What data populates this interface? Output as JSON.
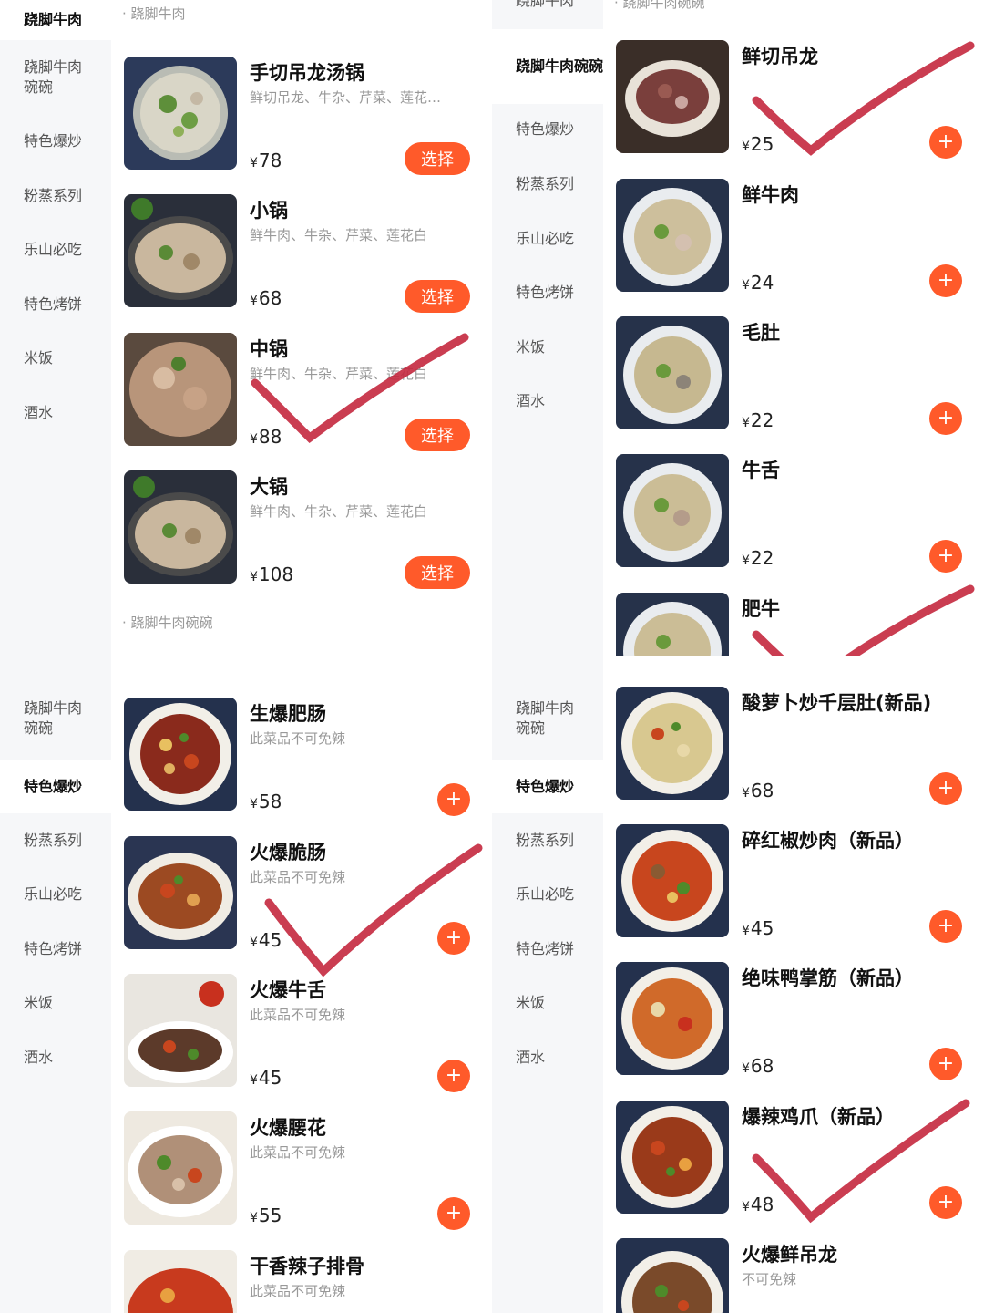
{
  "colors": {
    "accent": "#ff5a2a",
    "sidebar_bg": "#f6f7f9",
    "check_mark": "#c4283e"
  },
  "icons": {
    "add": "plus-icon"
  },
  "symbols": {
    "yen": "¥",
    "plus": "+",
    "ellipsis": "…"
  },
  "panels": [
    {
      "sidebar": [
        {
          "label": "跷脚牛肉",
          "active": true
        },
        {
          "label": "跷脚牛肉碗碗"
        },
        {
          "label": "特色爆炒"
        },
        {
          "label": "粉蒸系列"
        },
        {
          "label": "乐山必吃"
        },
        {
          "label": "特色烤饼"
        },
        {
          "label": "米饭"
        },
        {
          "label": "酒水"
        }
      ],
      "section_top": "· 跷脚牛肉",
      "section_bottom": "· 跷脚牛肉碗碗",
      "button_label": "选择",
      "items": [
        {
          "name": "手切吊龙汤锅",
          "desc": "鲜切吊龙、牛杂、芹菜、莲花…",
          "price": "78"
        },
        {
          "name": "小锅",
          "desc": "鲜牛肉、牛杂、芹菜、莲花白",
          "price": "68"
        },
        {
          "name": "中锅",
          "desc": "鲜牛肉、牛杂、芹菜、莲花白",
          "price": "88"
        },
        {
          "name": "大锅",
          "desc": "鲜牛肉、牛杂、芹菜、莲花白",
          "price": "108"
        }
      ]
    },
    {
      "sidebar": [
        {
          "label": "跷脚牛肉"
        },
        {
          "label": "跷脚牛肉碗碗",
          "active": true
        },
        {
          "label": "特色爆炒"
        },
        {
          "label": "粉蒸系列"
        },
        {
          "label": "乐山必吃"
        },
        {
          "label": "特色烤饼"
        },
        {
          "label": "米饭"
        },
        {
          "label": "酒水"
        }
      ],
      "section_top": "· 跷脚牛肉碗碗",
      "items": [
        {
          "name": "鲜切吊龙",
          "price": "25"
        },
        {
          "name": "鲜牛肉",
          "price": "24"
        },
        {
          "name": "毛肚",
          "price": "22"
        },
        {
          "name": "牛舌",
          "price": "22"
        },
        {
          "name": "肥牛"
        }
      ]
    },
    {
      "sidebar": [
        {
          "label": "跷脚牛肉碗碗"
        },
        {
          "label": "特色爆炒",
          "active": true
        },
        {
          "label": "粉蒸系列"
        },
        {
          "label": "乐山必吃"
        },
        {
          "label": "特色烤饼"
        },
        {
          "label": "米饭"
        },
        {
          "label": "酒水"
        }
      ],
      "items": [
        {
          "name": "生爆肥肠",
          "desc": "此菜品不可免辣",
          "price": "58"
        },
        {
          "name": "火爆脆肠",
          "desc": "此菜品不可免辣",
          "price": "45"
        },
        {
          "name": "火爆牛舌",
          "desc": "此菜品不可免辣",
          "price": "45"
        },
        {
          "name": "火爆腰花",
          "desc": "此菜品不可免辣",
          "price": "55"
        },
        {
          "name": "干香辣子排骨",
          "desc": "此菜品不可免辣"
        }
      ]
    },
    {
      "sidebar": [
        {
          "label": "跷脚牛肉碗碗"
        },
        {
          "label": "特色爆炒",
          "active": true
        },
        {
          "label": "粉蒸系列"
        },
        {
          "label": "乐山必吃"
        },
        {
          "label": "特色烤饼"
        },
        {
          "label": "米饭"
        },
        {
          "label": "酒水"
        }
      ],
      "items": [
        {
          "name": "酸萝卜炒千层肚(新品)",
          "price": "68"
        },
        {
          "name": "碎红椒炒肉（新品）",
          "price": "45"
        },
        {
          "name": "绝味鸭掌筋（新品）",
          "price": "68"
        },
        {
          "name": "爆辣鸡爪（新品）",
          "price": "48"
        },
        {
          "name": "火爆鲜吊龙",
          "desc": "不可免辣"
        }
      ]
    }
  ]
}
